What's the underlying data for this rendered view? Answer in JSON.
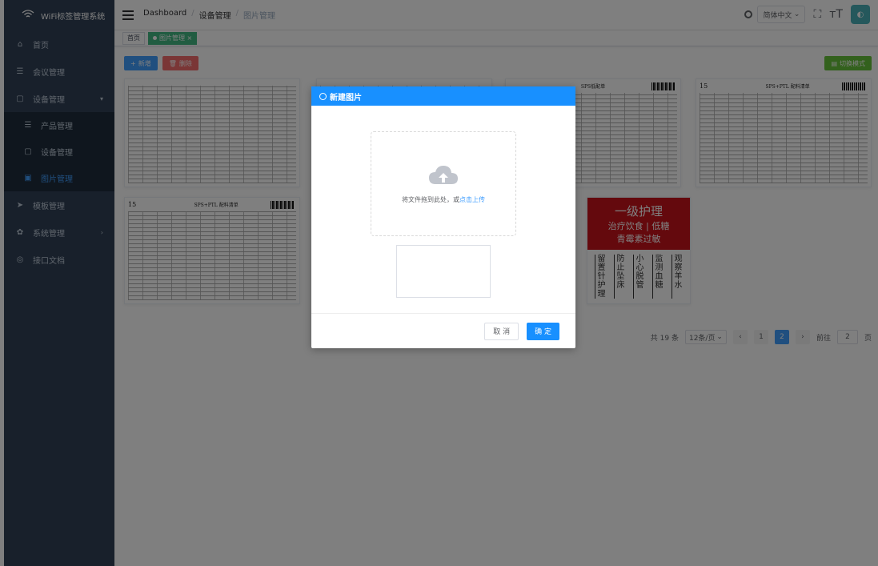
{
  "app": {
    "logo_text": "WiFi标签管理系统",
    "logo_subtext": "WiFi"
  },
  "sidebar": {
    "items": [
      {
        "label": "首页",
        "icon": "home-icon"
      },
      {
        "label": "会议管理",
        "icon": "list-icon"
      },
      {
        "label": "设备管理",
        "icon": "device-icon"
      },
      {
        "label": "产品管理",
        "icon": "list-icon"
      },
      {
        "label": "设备管理",
        "icon": "device-icon"
      },
      {
        "label": "图片管理",
        "icon": "image-icon"
      },
      {
        "label": "模板管理",
        "icon": "send-icon"
      },
      {
        "label": "系统管理",
        "icon": "gear-icon"
      },
      {
        "label": "接口文档",
        "icon": "globe-icon"
      }
    ]
  },
  "navbar": {
    "breadcrumb": [
      "Dashboard",
      "设备管理",
      "图片管理"
    ],
    "lang_label": "简体中文"
  },
  "tags": [
    "首页",
    "图片管理"
  ],
  "toolbar": {
    "add_label": "新增",
    "delete_label": "删除",
    "switch_label": "切换模式"
  },
  "gallery": {
    "sheet_titles": [
      "",
      "",
      "SPS低配单",
      "SPS+PTL 配料清单",
      "SPS+PTL 配料清单"
    ],
    "sheet_numbers": [
      "15",
      "15"
    ],
    "nurse": {
      "title": "一级护理",
      "line2": "治疗饮食 | 低糖",
      "line3": "青霉素过敏",
      "cols": [
        "留置针护理",
        "防止坠床",
        "小心脱管",
        "监测血糖",
        "观察羊水"
      ]
    }
  },
  "pagination": {
    "total": "共 19 条",
    "page_size": "12条/页",
    "pages": [
      "1",
      "2"
    ],
    "current": "2",
    "goto_label": "前往",
    "goto_value": "2",
    "goto_suffix": "页"
  },
  "dialog": {
    "title": "新建图片",
    "upload_text": "将文件拖到此处，或",
    "upload_link": "点击上传",
    "cancel": "取 消",
    "ok": "确 定"
  },
  "colors": {
    "sidebar_bg": "#304156",
    "primary": "#1890ff",
    "danger": "#f56c6c",
    "success": "#67c23a",
    "tag_active": "#42b983",
    "nurse_red": "#c9131b"
  }
}
